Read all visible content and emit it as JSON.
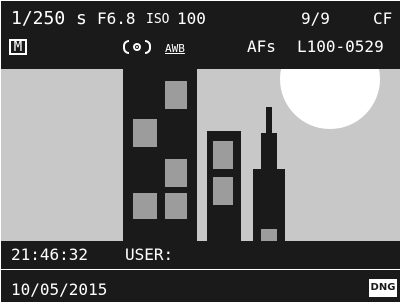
{
  "top_bar": {
    "shutter": "1/250 s",
    "aperture": "F6.8",
    "iso_label": "ISO",
    "iso_value": "100",
    "frames": "9/9",
    "storage": "CF"
  },
  "second_bar": {
    "mode": "M",
    "white_balance": "AWB",
    "af_mode": "AFs",
    "file_number": "L100-0529"
  },
  "bottom_bar": {
    "time": "21:46:32",
    "user": "USER:",
    "date": "10/05/2015",
    "file_format": "DNG"
  },
  "icons": {
    "metering": "spot-metering-icon"
  },
  "colors": {
    "background": "#1a1a1a",
    "sky": "#c8c8c8",
    "windows": "#9c9c9c",
    "sun": "#ffffff",
    "text": "#ffffff"
  }
}
